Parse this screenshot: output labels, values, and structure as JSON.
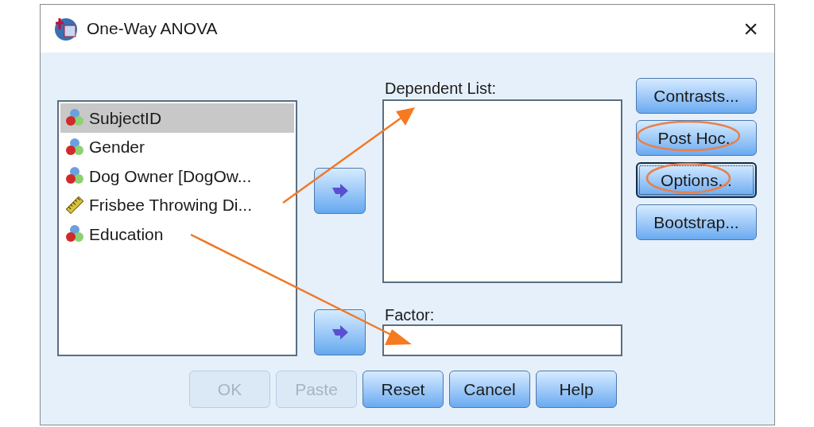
{
  "window": {
    "title": "One-Way ANOVA",
    "close": "×"
  },
  "variables": [
    {
      "label": "SubjectID",
      "kind": "nominal",
      "selected": true
    },
    {
      "label": "Gender",
      "kind": "nominal",
      "selected": false
    },
    {
      "label": "Dog Owner [DogOw...",
      "kind": "nominal",
      "selected": false
    },
    {
      "label": "Frisbee Throwing Di...",
      "kind": "scale",
      "selected": false
    },
    {
      "label": "Education",
      "kind": "nominal",
      "selected": false
    }
  ],
  "dependent_list": {
    "label": "Dependent List:"
  },
  "factor": {
    "label": "Factor:"
  },
  "side_buttons": [
    {
      "label": "Contrasts...",
      "focused": false,
      "circled": false
    },
    {
      "label": "Post Hoc..",
      "focused": false,
      "circled": true
    },
    {
      "label": "Options...",
      "focused": true,
      "circled": true
    },
    {
      "label": "Bootstrap...",
      "focused": false,
      "circled": false
    }
  ],
  "bottom_buttons": [
    {
      "label": "OK",
      "disabled": true
    },
    {
      "label": "Paste",
      "disabled": true
    },
    {
      "label": "Reset",
      "disabled": false
    },
    {
      "label": "Cancel",
      "disabled": false
    },
    {
      "label": "Help",
      "disabled": false
    }
  ]
}
